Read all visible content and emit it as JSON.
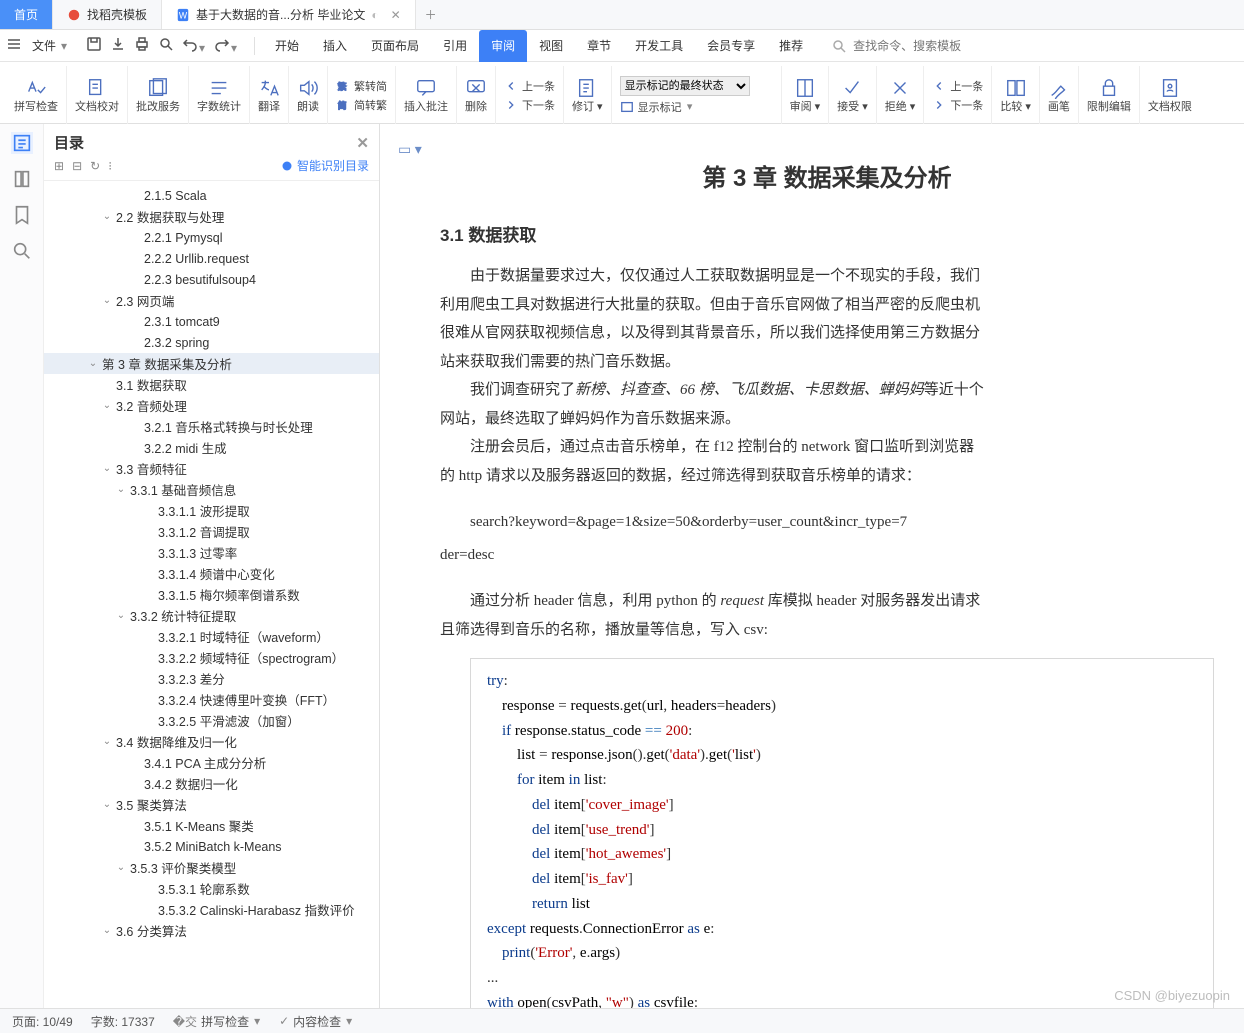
{
  "tabs": {
    "home": "首页",
    "t1": "找稻壳模板",
    "t2": "基于大数据的音...分析 毕业论文"
  },
  "menubar": {
    "file": "文件",
    "menus": [
      "开始",
      "插入",
      "页面布局",
      "引用",
      "审阅",
      "视图",
      "章节",
      "开发工具",
      "会员专享",
      "推荐"
    ],
    "active": "审阅",
    "search_ph": "查找命令、搜索模板"
  },
  "ribbon": {
    "spell": "拼写检查",
    "proof": "文档校对",
    "batch": "批改服务",
    "wordcount": "字数统计",
    "translate": "翻译",
    "read": "朗读",
    "convertA": "繁转简",
    "convertB": "简转繁",
    "insertcmt": "插入批注",
    "delete": "删除",
    "prevcmt": "上一条",
    "nextcmt": "下一条",
    "revise": "修订",
    "show_select": "显示标记的最终状态",
    "showmarks": "显示标记",
    "review": "审阅",
    "accept": "接受",
    "reject": "拒绝",
    "revprev": "上一条",
    "revnext": "下一条",
    "compare": "比较",
    "pen": "画笔",
    "restrict": "限制编辑",
    "perm": "文档权限"
  },
  "toc": {
    "title": "目录",
    "ai": "智能识别目录",
    "items": [
      {
        "pad": 100,
        "chev": "",
        "txt": "2.1.5 Scala"
      },
      {
        "pad": 72,
        "chev": "v",
        "txt": "2.2 数据获取与处理"
      },
      {
        "pad": 100,
        "chev": "",
        "txt": "2.2.1 Pymysql"
      },
      {
        "pad": 100,
        "chev": "",
        "txt": "2.2.2 Urllib.request"
      },
      {
        "pad": 100,
        "chev": "",
        "txt": "2.2.3 besutifulsoup4"
      },
      {
        "pad": 72,
        "chev": "v",
        "txt": "2.3 网页端"
      },
      {
        "pad": 100,
        "chev": "",
        "txt": "2.3.1 tomcat9"
      },
      {
        "pad": 100,
        "chev": "",
        "txt": "2.3.2 spring"
      },
      {
        "pad": 58,
        "chev": "v",
        "txt": "第 3 章 数据采集及分析",
        "sel": true
      },
      {
        "pad": 72,
        "chev": "",
        "txt": "3.1 数据获取"
      },
      {
        "pad": 72,
        "chev": "v",
        "txt": "3.2 音频处理"
      },
      {
        "pad": 100,
        "chev": "",
        "txt": "3.2.1 音乐格式转换与时长处理"
      },
      {
        "pad": 100,
        "chev": "",
        "txt": "3.2.2 midi 生成"
      },
      {
        "pad": 72,
        "chev": "v",
        "txt": "3.3 音频特征"
      },
      {
        "pad": 86,
        "chev": "v",
        "txt": "3.3.1 基础音频信息"
      },
      {
        "pad": 114,
        "chev": "",
        "txt": "3.3.1.1 波形提取"
      },
      {
        "pad": 114,
        "chev": "",
        "txt": "3.3.1.2 音调提取"
      },
      {
        "pad": 114,
        "chev": "",
        "txt": "3.3.1.3 过零率"
      },
      {
        "pad": 114,
        "chev": "",
        "txt": "3.3.1.4 频谱中心变化"
      },
      {
        "pad": 114,
        "chev": "",
        "txt": "3.3.1.5 梅尔频率倒谱系数"
      },
      {
        "pad": 86,
        "chev": "v",
        "txt": "3.3.2 统计特征提取"
      },
      {
        "pad": 114,
        "chev": "",
        "txt": "3.3.2.1 时域特征（waveform）"
      },
      {
        "pad": 114,
        "chev": "",
        "txt": "3.3.2.2 频域特征（spectrogram）"
      },
      {
        "pad": 114,
        "chev": "",
        "txt": "3.3.2.3 差分"
      },
      {
        "pad": 114,
        "chev": "",
        "txt": "3.3.2.4 快速傅里叶变换（FFT）"
      },
      {
        "pad": 114,
        "chev": "",
        "txt": "3.3.2.5 平滑滤波（加窗）"
      },
      {
        "pad": 72,
        "chev": "v",
        "txt": "3.4 数据降维及归一化"
      },
      {
        "pad": 100,
        "chev": "",
        "txt": "3.4.1 PCA 主成分分析"
      },
      {
        "pad": 100,
        "chev": "",
        "txt": "3.4.2 数据归一化"
      },
      {
        "pad": 72,
        "chev": "v",
        "txt": "3.5 聚类算法"
      },
      {
        "pad": 100,
        "chev": "",
        "txt": "3.5.1 K-Means 聚类"
      },
      {
        "pad": 100,
        "chev": "",
        "txt": "3.5.2 MiniBatch k-Means"
      },
      {
        "pad": 86,
        "chev": "v",
        "txt": "3.5.3 评价聚类模型"
      },
      {
        "pad": 114,
        "chev": "",
        "txt": "3.5.3.1 轮廓系数"
      },
      {
        "pad": 114,
        "chev": "",
        "txt": "3.5.3.2 Calinski-Harabasz 指数评价"
      },
      {
        "pad": 72,
        "chev": "v",
        "txt": "3.6 分类算法"
      }
    ]
  },
  "doc": {
    "h1": "第 3 章  数据采集及分析",
    "h2": "3.1  数据获取",
    "p1": "由于数据量要求过大，仅仅通过人工获取数据明显是一个不现实的手段，我们",
    "p2": "利用爬虫工具对数据进行大批量的获取。但由于音乐官网做了相当严密的反爬虫机",
    "p3": "很难从官网获取视频信息，以及得到其背景音乐，所以我们选择使用第三方数据分",
    "p4": "站来获取我们需要的热门音乐数据。",
    "p5a": "我们调查研究了",
    "p5i": "新榜、抖查查、66 榜、飞瓜数据、卡思数据、蝉妈妈",
    "p5b": "等近十个",
    "p6": "网站，最终选取了蝉妈妈作为音乐数据来源。",
    "p7": "注册会员后，通过点击音乐榜单，在 f12 控制台的 network 窗口监听到浏览器",
    "p8": "的 http 请求以及服务器返回的数据，经过筛选得到获取音乐榜单的请求：",
    "url1": "search?keyword=&page=1&size=50&orderby=user_count&incr_type=7",
    "url2": "der=desc",
    "p9a": "通过分析 header 信息，利用 python 的 ",
    "p9i": "request",
    "p9b": " 库模拟 header 对服务器发出请求",
    "p10": "且筛选得到音乐的名称，播放量等信息，写入 csv:",
    "code": [
      "try:",
      "    response = requests.get(url, headers=headers)",
      "    if response.status_code == 200:",
      "        list = response.json().get('data').get('list')",
      "        for item in list:",
      "            del item['cover_image']",
      "            del item['use_trend']",
      "            del item['hot_awemes']",
      "            del item['is_fav']",
      "            return list",
      "except requests.ConnectionError as e:",
      "    print('Error', e.args)",
      "...",
      "with open(csvPath, \"w\") as csvfile:"
    ]
  },
  "status": {
    "page": "页面: 10/49",
    "words": "字数: 17337",
    "spell": "拼写检查",
    "content": "内容检查"
  },
  "watermark": "CSDN @biyezuopin"
}
